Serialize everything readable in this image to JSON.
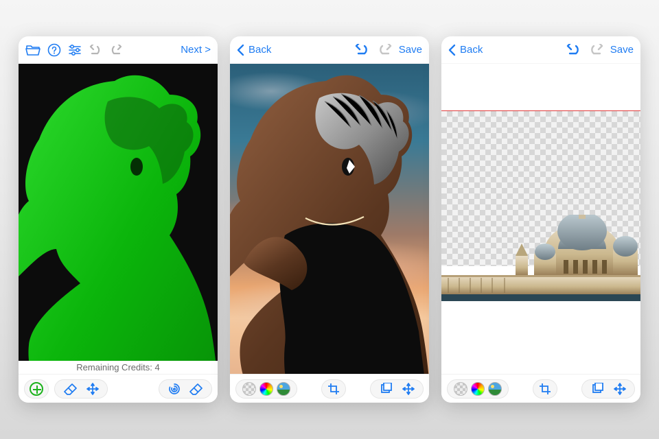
{
  "screens": [
    {
      "top": {
        "next_label": "Next >"
      },
      "credits_text": "Remaining Credits: 4"
    },
    {
      "top": {
        "back_label": "Back",
        "save_label": "Save"
      }
    },
    {
      "top": {
        "back_label": "Back",
        "save_label": "Save"
      }
    }
  ]
}
